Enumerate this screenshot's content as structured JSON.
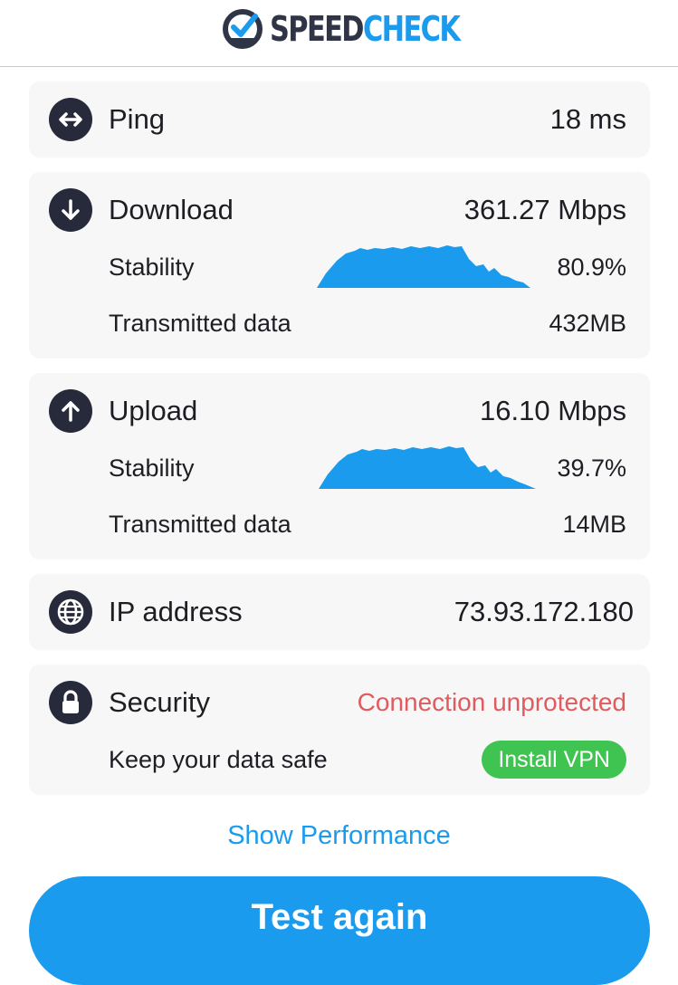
{
  "header": {
    "logo_speed": "SPEED",
    "logo_check": "CHECK"
  },
  "ping": {
    "icon": "double-arrow-horizontal-icon",
    "label": "Ping",
    "value": "18 ms"
  },
  "download": {
    "icon": "arrow-down-circle-icon",
    "label": "Download",
    "value": "361.27 Mbps",
    "stability_label": "Stability",
    "stability_value": "80.9%",
    "transmitted_label": "Transmitted data",
    "transmitted_value": "432MB"
  },
  "upload": {
    "icon": "arrow-up-circle-icon",
    "label": "Upload",
    "value": "16.10 Mbps",
    "stability_label": "Stability",
    "stability_value": "39.7%",
    "transmitted_label": "Transmitted data",
    "transmitted_value": "14MB"
  },
  "ip": {
    "icon": "globe-icon",
    "label": "IP address",
    "value": "73.93.172.180"
  },
  "security": {
    "icon": "lock-icon",
    "label": "Security",
    "status": "Connection unprotected",
    "sub_label": "Keep your data safe",
    "vpn_button": "Install VPN"
  },
  "show_performance": "Show Performance",
  "test_again": "Test again",
  "colors": {
    "brand_blue": "#1a9bee",
    "brand_dark": "#2f3447",
    "danger": "#e05a5e",
    "success": "#3fc451"
  }
}
